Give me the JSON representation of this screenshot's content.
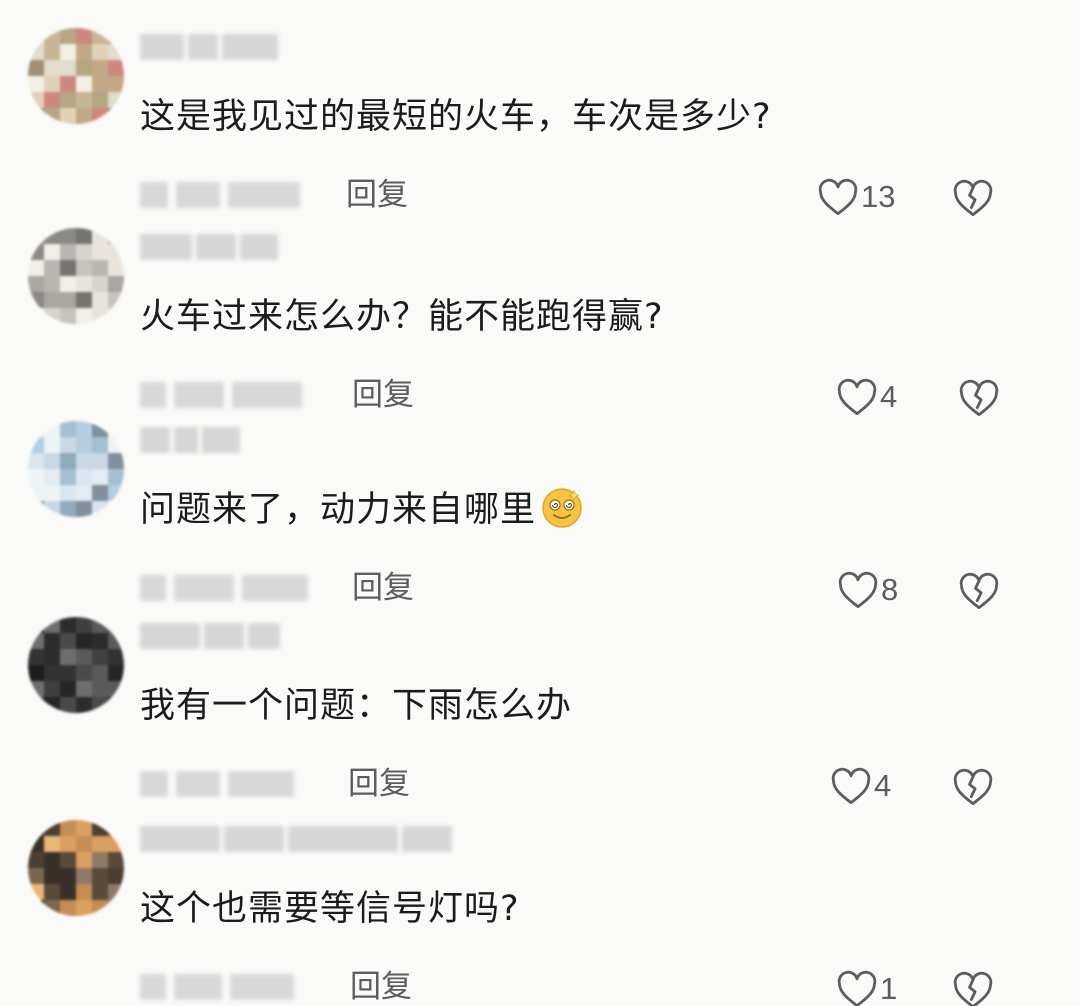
{
  "reply_label": "回复",
  "colors": {
    "text": "#1c1c1c",
    "secondary": "#5d5d5d",
    "background": "#fafaf8"
  },
  "comments": [
    {
      "text": "这是我见过的最短的火车，车次是多少?",
      "likes": "13",
      "has_emoji": false,
      "avatar_palette": [
        "#c8b596",
        "#e0d2b8",
        "#9e8f76",
        "#c2a984",
        "#e2dccd",
        "#f4efe4",
        "#cc8880",
        "#b5a583"
      ]
    },
    {
      "text": "火车过来怎么办？能不能跑得赢?",
      "likes": "4",
      "has_emoji": false,
      "avatar_palette": [
        "#b9b6b2",
        "#d7d4cf",
        "#8b8986",
        "#e8e4dd",
        "#a9a6a2",
        "#f2efe9",
        "#c6c2bd",
        "#757370"
      ]
    },
    {
      "text": "问题来了，动力来自哪里",
      "likes": "8",
      "has_emoji": true,
      "emoji_icon": "dizzy-face-emoji-icon",
      "avatar_palette": [
        "#b4cde0",
        "#d9e6ef",
        "#8fa9bd",
        "#eef3f6",
        "#c8d8e4",
        "#a4bfd2",
        "#e3ecf2",
        "#7f8f9c"
      ]
    },
    {
      "text": "我有一个问题：下雨怎么办",
      "likes": "4",
      "has_emoji": false,
      "avatar_palette": [
        "#2c2c2c",
        "#404040",
        "#1d1d1d",
        "#5a5a5a",
        "#333333",
        "#6e6e6e",
        "#262626",
        "#4a4a4a"
      ]
    },
    {
      "text": "这个也需要等信号灯吗?",
      "likes": "1",
      "has_emoji": false,
      "avatar_palette": [
        "#5a4a3a",
        "#7d6650",
        "#d9a060",
        "#3a302a",
        "#c48d52",
        "#8f7a66",
        "#e8b878",
        "#4c3e32"
      ]
    }
  ]
}
